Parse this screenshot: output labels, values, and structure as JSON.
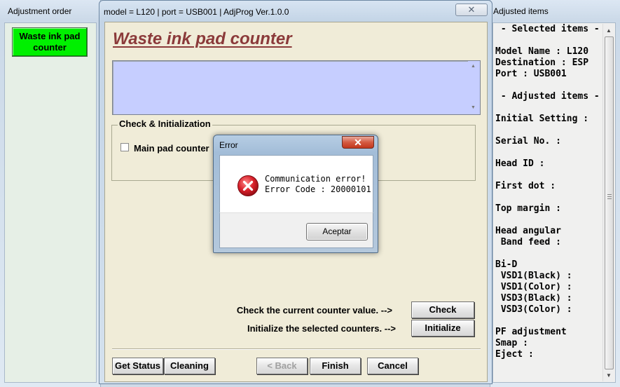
{
  "left_window": {
    "title": "Adjustment order",
    "button_label": "Waste ink pad\ncounter",
    "button_color": "#00f000"
  },
  "main_window": {
    "title": "model = L120 | port = USB001 | AdjProg Ver.1.0.0",
    "close_symbol": "✕",
    "heading": "Waste ink pad counter",
    "heading_color": "#8b3a3a",
    "textbox_color": "#c6ceff",
    "group_label": "Check & Initialization",
    "checkbox_label": "Main pad counter",
    "checkbox_checked": false,
    "check_text": "Check the current counter value. -->",
    "check_button": "Check",
    "init_text": "Initialize the selected counters. -->",
    "init_button": "Initialize",
    "buttons": {
      "get_status": "Get Status",
      "cleaning": "Cleaning",
      "back": "< Back",
      "finish": "Finish",
      "cancel": "Cancel"
    }
  },
  "error_dialog": {
    "title": "Error",
    "close_symbol": "✕",
    "icon": "error-icon",
    "line1": "Communication error!",
    "line2": "Error Code : 20000101",
    "ok_button": "Aceptar",
    "icon_color": "#d8202a"
  },
  "right_window": {
    "title": "Adjusted items",
    "content": " - Selected items -\n\nModel Name : L120\nDestination : ESP\nPort : USB001\n\n - Adjusted items -\n\nInitial Setting :\n\nSerial No. :\n\nHead ID :\n\nFirst dot :\n\nTop margin :\n\nHead angular\n Band feed :\n\nBi-D\n VSD1(Black) :\n VSD1(Color) :\n VSD3(Black) :\n VSD3(Color) :\n\nPF adjustment\nSmap :\nEject :"
  }
}
